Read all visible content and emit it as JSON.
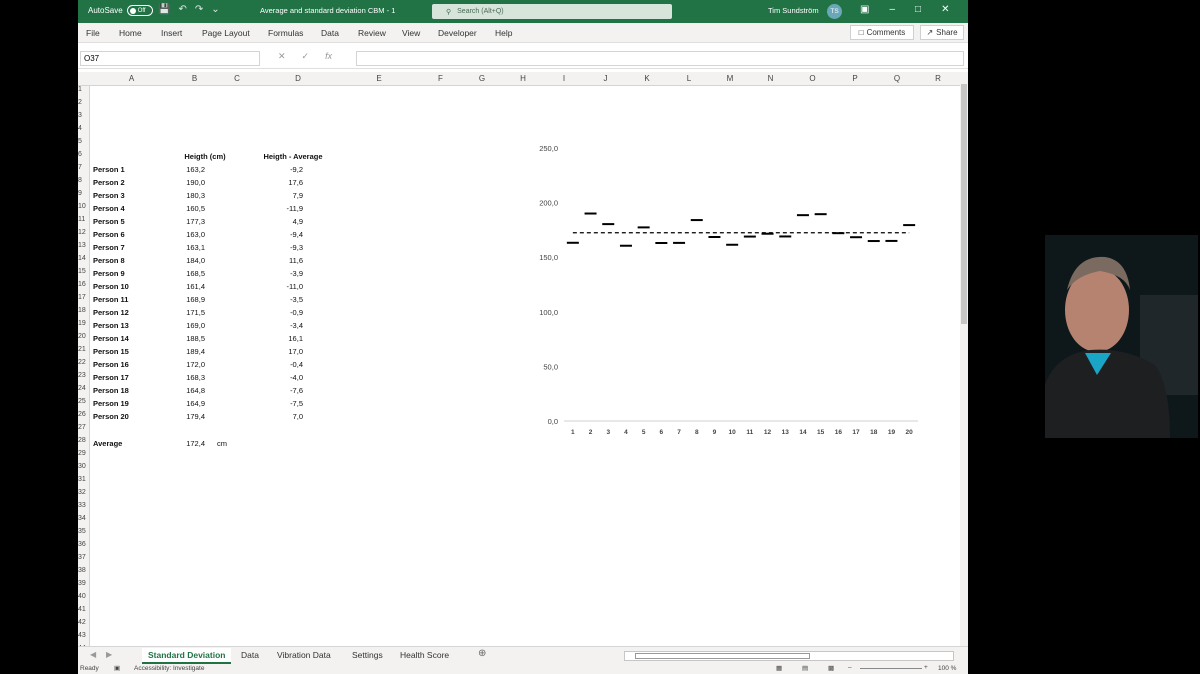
{
  "titlebar": {
    "autosave_label": "AutoSave",
    "autosave_state": "Off",
    "file_title": "Average and standard deviation CBM  -  1",
    "search_placeholder": "Search (Alt+Q)",
    "user_name": "Tim Sundström",
    "user_initials": "TS"
  },
  "menu": {
    "items": [
      "File",
      "Home",
      "Insert",
      "Page Layout",
      "Formulas",
      "Data",
      "Review",
      "View",
      "Developer",
      "Help"
    ],
    "comments_label": "Comments",
    "share_label": "Share"
  },
  "formula_bar": {
    "name_box": "O37",
    "formula": ""
  },
  "columns": [
    "A",
    "B",
    "C",
    "D",
    "E",
    "F",
    "G",
    "H",
    "I",
    "J",
    "K",
    "L",
    "M",
    "N",
    "O",
    "P",
    "Q",
    "R"
  ],
  "rows": [
    "1",
    "2",
    "3",
    "4",
    "5",
    "6",
    "7",
    "8",
    "9",
    "10",
    "11",
    "12",
    "13",
    "14",
    "15",
    "16",
    "17",
    "18",
    "19",
    "20",
    "21",
    "22",
    "23",
    "24",
    "25",
    "26",
    "27",
    "28",
    "29",
    "30",
    "31",
    "32",
    "33",
    "34",
    "35",
    "36",
    "37",
    "38",
    "39",
    "40",
    "41",
    "42",
    "43",
    "44"
  ],
  "sheet": {
    "header_height": "Heigth (cm)",
    "header_diff": "Heigth - Average",
    "people": [
      {
        "name": "Person 1",
        "height": "163,2",
        "diff": "-9,2"
      },
      {
        "name": "Person 2",
        "height": "190,0",
        "diff": "17,6"
      },
      {
        "name": "Person 3",
        "height": "180,3",
        "diff": "7,9"
      },
      {
        "name": "Person 4",
        "height": "160,5",
        "diff": "-11,9"
      },
      {
        "name": "Person 5",
        "height": "177,3",
        "diff": "4,9"
      },
      {
        "name": "Person 6",
        "height": "163,0",
        "diff": "-9,4"
      },
      {
        "name": "Person 7",
        "height": "163,1",
        "diff": "-9,3"
      },
      {
        "name": "Person 8",
        "height": "184,0",
        "diff": "11,6"
      },
      {
        "name": "Person 9",
        "height": "168,5",
        "diff": "-3,9"
      },
      {
        "name": "Person 10",
        "height": "161,4",
        "diff": "-11,0"
      },
      {
        "name": "Person 11",
        "height": "168,9",
        "diff": "-3,5"
      },
      {
        "name": "Person 12",
        "height": "171,5",
        "diff": "-0,9"
      },
      {
        "name": "Person 13",
        "height": "169,0",
        "diff": "-3,4"
      },
      {
        "name": "Person 14",
        "height": "188,5",
        "diff": "16,1"
      },
      {
        "name": "Person 15",
        "height": "189,4",
        "diff": "17,0"
      },
      {
        "name": "Person 16",
        "height": "172,0",
        "diff": "-0,4"
      },
      {
        "name": "Person 17",
        "height": "168,3",
        "diff": "-4,0"
      },
      {
        "name": "Person 18",
        "height": "164,8",
        "diff": "-7,6"
      },
      {
        "name": "Person 19",
        "height": "164,9",
        "diff": "-7,5"
      },
      {
        "name": "Person 20",
        "height": "179,4",
        "diff": "7,0"
      }
    ],
    "average_label": "Average",
    "average_value": "172,4",
    "average_unit": "cm"
  },
  "chart_data": {
    "type": "line",
    "title": "",
    "x": [
      "1",
      "2",
      "3",
      "4",
      "5",
      "6",
      "7",
      "8",
      "9",
      "10",
      "11",
      "12",
      "13",
      "14",
      "15",
      "16",
      "17",
      "18",
      "19",
      "20"
    ],
    "series": [
      {
        "values": [
          163.2,
          190.0,
          180.3,
          160.5,
          177.3,
          163.0,
          163.1,
          184.0,
          168.5,
          161.4,
          168.9,
          171.5,
          169.0,
          188.5,
          189.4,
          172.0,
          168.3,
          164.8,
          164.9,
          179.4
        ],
        "marker": "dash"
      },
      {
        "values": [
          172.4,
          172.4,
          172.4,
          172.4,
          172.4,
          172.4,
          172.4,
          172.4,
          172.4,
          172.4,
          172.4,
          172.4,
          172.4,
          172.4,
          172.4,
          172.4,
          172.4,
          172.4,
          172.4,
          172.4
        ],
        "line": "dashed"
      }
    ],
    "ylim": [
      0,
      250
    ],
    "yticks": [
      "0,0",
      "50,0",
      "100,0",
      "150,0",
      "200,0",
      "250,0"
    ],
    "grid": false,
    "color": "#000000"
  },
  "tabs": [
    "Standard Deviation",
    "Data",
    "Vibration Data",
    "Settings",
    "Health Score"
  ],
  "status": {
    "ready": "Ready",
    "accessibility": "Accessibility: Investigate",
    "zoom": "100 %"
  },
  "accent_color": "#217346"
}
